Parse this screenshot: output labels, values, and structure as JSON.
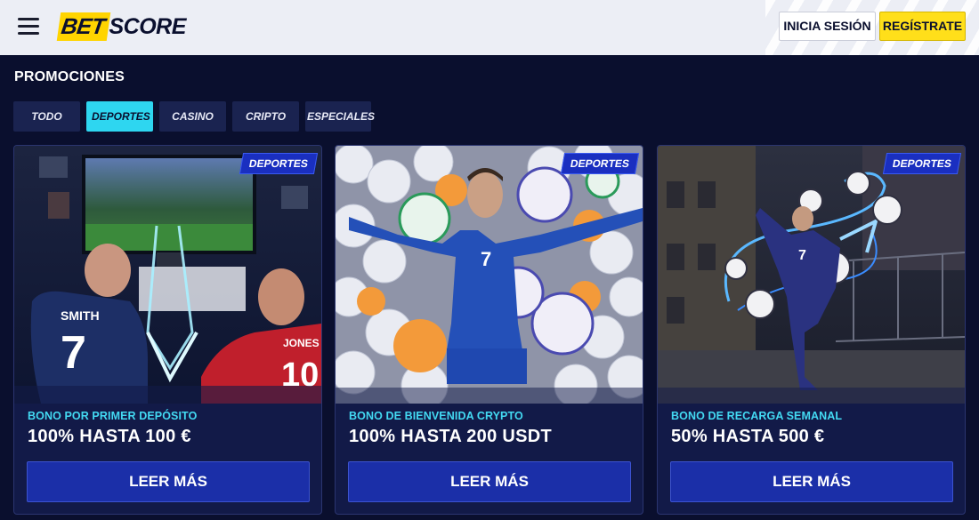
{
  "header": {
    "logo_bet": "BET",
    "logo_score": "SCORE",
    "login_label": "INICIA SESIÓN",
    "register_label": "REGÍSTRATE"
  },
  "page": {
    "title": "PROMOCIONES"
  },
  "tabs": [
    {
      "label": "TODO",
      "active": false
    },
    {
      "label": "DEPORTES",
      "active": true
    },
    {
      "label": "CASINO",
      "active": false
    },
    {
      "label": "CRIPTO",
      "active": false
    },
    {
      "label": "ESPECIALES",
      "active": false
    }
  ],
  "cards": [
    {
      "badge": "DEPORTES",
      "subtitle": "BONO POR PRIMER DEPÓSITO",
      "headline": "100% HASTA 100 €",
      "cta": "LEER MÁS",
      "jersey_left_name": "SMITH",
      "jersey_left_number": "7",
      "jersey_right_name": "JONES",
      "jersey_right_number": "10"
    },
    {
      "badge": "DEPORTES",
      "subtitle": "BONO DE BIENVENIDA CRYPTO",
      "headline": "100% HASTA 200 USDT",
      "cta": "LEER MÁS",
      "jersey_number": "7"
    },
    {
      "badge": "DEPORTES",
      "subtitle": "BONO DE RECARGA SEMANAL",
      "headline": "50% HASTA 500 €",
      "cta": "LEER MÁS",
      "jersey_number": "7"
    }
  ],
  "colors": {
    "background": "#0a0f2e",
    "accent_cyan": "#2ed6f0",
    "accent_yellow": "#ffdf1a",
    "card_bg": "#121a48",
    "cta_blue": "#1b2fa8"
  }
}
